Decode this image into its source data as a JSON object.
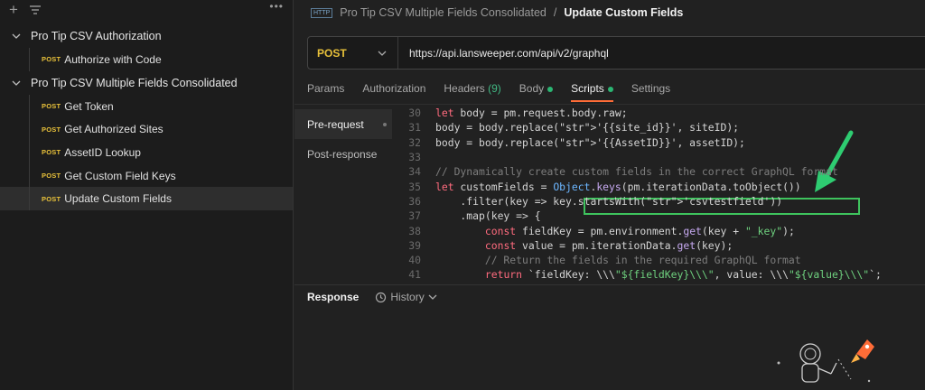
{
  "sidebar": {
    "folders": [
      {
        "label": "Pro Tip CSV Authorization",
        "requests": [
          {
            "method": "POST",
            "label": "Authorize with Code"
          }
        ]
      },
      {
        "label": "Pro Tip CSV Multiple Fields Consolidated",
        "requests": [
          {
            "method": "POST",
            "label": "Get Token"
          },
          {
            "method": "POST",
            "label": "Get Authorized Sites"
          },
          {
            "method": "POST",
            "label": "AssetID Lookup"
          },
          {
            "method": "POST",
            "label": "Get Custom Field Keys"
          },
          {
            "method": "POST",
            "label": "Update Custom Fields"
          }
        ]
      }
    ]
  },
  "breadcrumb": {
    "badge": "HTTP",
    "collection": "Pro Tip CSV Multiple Fields Consolidated",
    "separator": "/",
    "current": "Update Custom Fields"
  },
  "request": {
    "method": "POST",
    "url": "https://api.lansweeper.com/api/v2/graphql"
  },
  "tabs": {
    "params": "Params",
    "authorization": "Authorization",
    "headers": "Headers",
    "headers_count": "(9)",
    "body": "Body",
    "scripts": "Scripts",
    "settings": "Settings"
  },
  "scripts_side": {
    "pre_request": "Pre-request",
    "post_response": "Post-response"
  },
  "code_lines": [
    {
      "n": "30",
      "text": "let body = pm.request.body.raw;"
    },
    {
      "n": "31",
      "text": "body = body.replace('{{site_id}}', siteID);"
    },
    {
      "n": "32",
      "text": "body = body.replace('{{AssetID}}', assetID);"
    },
    {
      "n": "33",
      "text": ""
    },
    {
      "n": "34",
      "text": "// Dynamically create custom fields in the correct GraphQL format"
    },
    {
      "n": "35",
      "text": "let customFields = Object.keys(pm.iterationData.toObject())"
    },
    {
      "n": "36",
      "text": "    .filter(key => key.startsWith('csvtestfield'))"
    },
    {
      "n": "37",
      "text": "    .map(key => {"
    },
    {
      "n": "38",
      "text": "        const fieldKey = pm.environment.get(key + \"_key\");"
    },
    {
      "n": "39",
      "text": "        const value = pm.iterationData.get(key);"
    },
    {
      "n": "40",
      "text": "        // Return the fields in the required GraphQL format"
    },
    {
      "n": "41",
      "text": "        return `fieldKey: \\\\\\\"${fieldKey}\\\\\\\", value: \\\\\\\"${value}\\\\\\\"`;"
    }
  ],
  "response": {
    "title": "Response",
    "history": "History"
  },
  "colors": {
    "accent": "#ff6c37",
    "method_post": "#e8c13a",
    "highlight": "#3ec35d",
    "indicator": "#2bb673"
  },
  "icons": [
    "plus-icon",
    "filter-icon",
    "more-icon",
    "chevron-down-icon",
    "history-icon",
    "arrow-annotation-icon",
    "rocket-illustration"
  ]
}
